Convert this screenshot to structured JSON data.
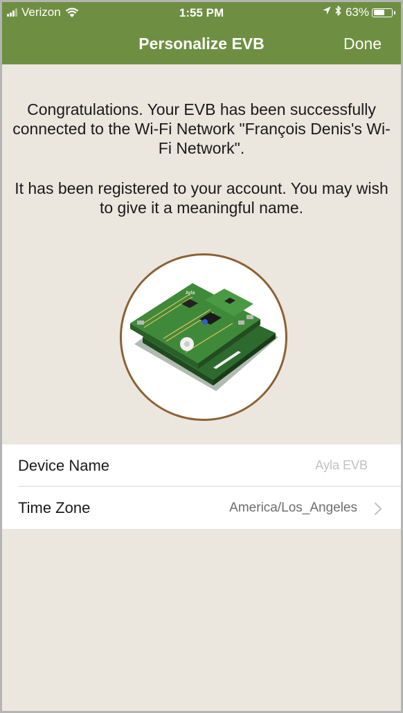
{
  "status_bar": {
    "carrier": "Verizon",
    "time": "1:55 PM",
    "battery_percent": "63%",
    "battery_level": 0.63,
    "signal_bars_filled": 3,
    "signal_bars_total": 4,
    "icons": [
      "signal-icon",
      "wifi-icon",
      "location-arrow-icon",
      "bluetooth-icon",
      "battery-icon"
    ]
  },
  "nav": {
    "title": "Personalize EVB",
    "done_label": "Done"
  },
  "message": {
    "line1": "Congratulations. Your EVB has been successfully connected to the Wi-Fi Network \"François Denis's Wi-Fi Network\".",
    "line2": "It has been registered to your account. You may wish to give it a meaningful name."
  },
  "device_image": {
    "board_label": "Ayla"
  },
  "form": {
    "device_name_label": "Device Name",
    "device_name_placeholder": "Ayla EVB",
    "device_name_value": "",
    "time_zone_label": "Time Zone",
    "time_zone_value": "America/Los_Angeles"
  },
  "colors": {
    "header": "#6e8f41",
    "background": "#ebe6de",
    "circle_border": "#8b6133",
    "board_green": "#3f8a3a"
  }
}
